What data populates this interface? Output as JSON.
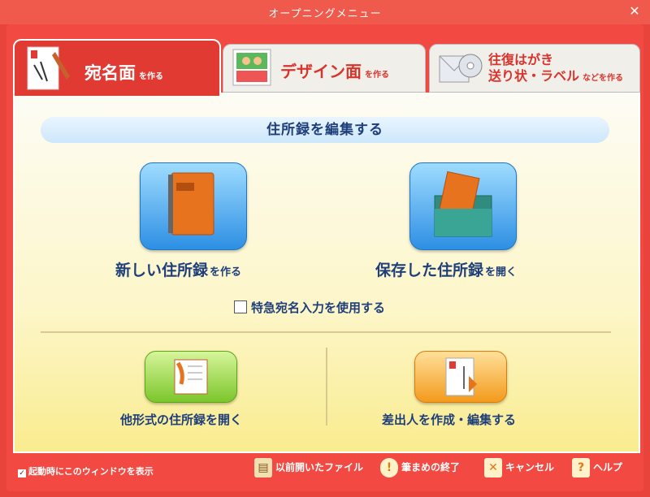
{
  "window": {
    "title": "オープニングメニュー",
    "close_label": "✕"
  },
  "tabs": [
    {
      "label": "宛名面",
      "sub": "を作る",
      "active": true
    },
    {
      "label": "デザイン面",
      "sub": "を作る",
      "active": false
    },
    {
      "label_line1": "往復はがき",
      "label_line2": "送り状・ラベル",
      "sub": "などを作る",
      "active": false
    }
  ],
  "section": {
    "header": "住所録を編集する"
  },
  "actions": {
    "new": {
      "label": "新しい住所録",
      "sub": "を作る"
    },
    "saved": {
      "label": "保存した住所録",
      "sub": "を開く"
    },
    "quick_input": "特急宛名入力を使用する",
    "other_format": "他形式の住所録を開く",
    "sender": "差出人を作成・編集する"
  },
  "footer": {
    "startup_check": "起動時にこのウィンドウを表示",
    "previous_file": "以前開いたファイル",
    "exit": "筆まめの終了",
    "cancel": "キャンセル",
    "help": "ヘルプ"
  },
  "colors": {
    "accent": "#e8443c",
    "blue": "#2d8fe3",
    "green": "#7cc62b",
    "orange": "#f39a1c",
    "text": "#1f3f7a"
  }
}
